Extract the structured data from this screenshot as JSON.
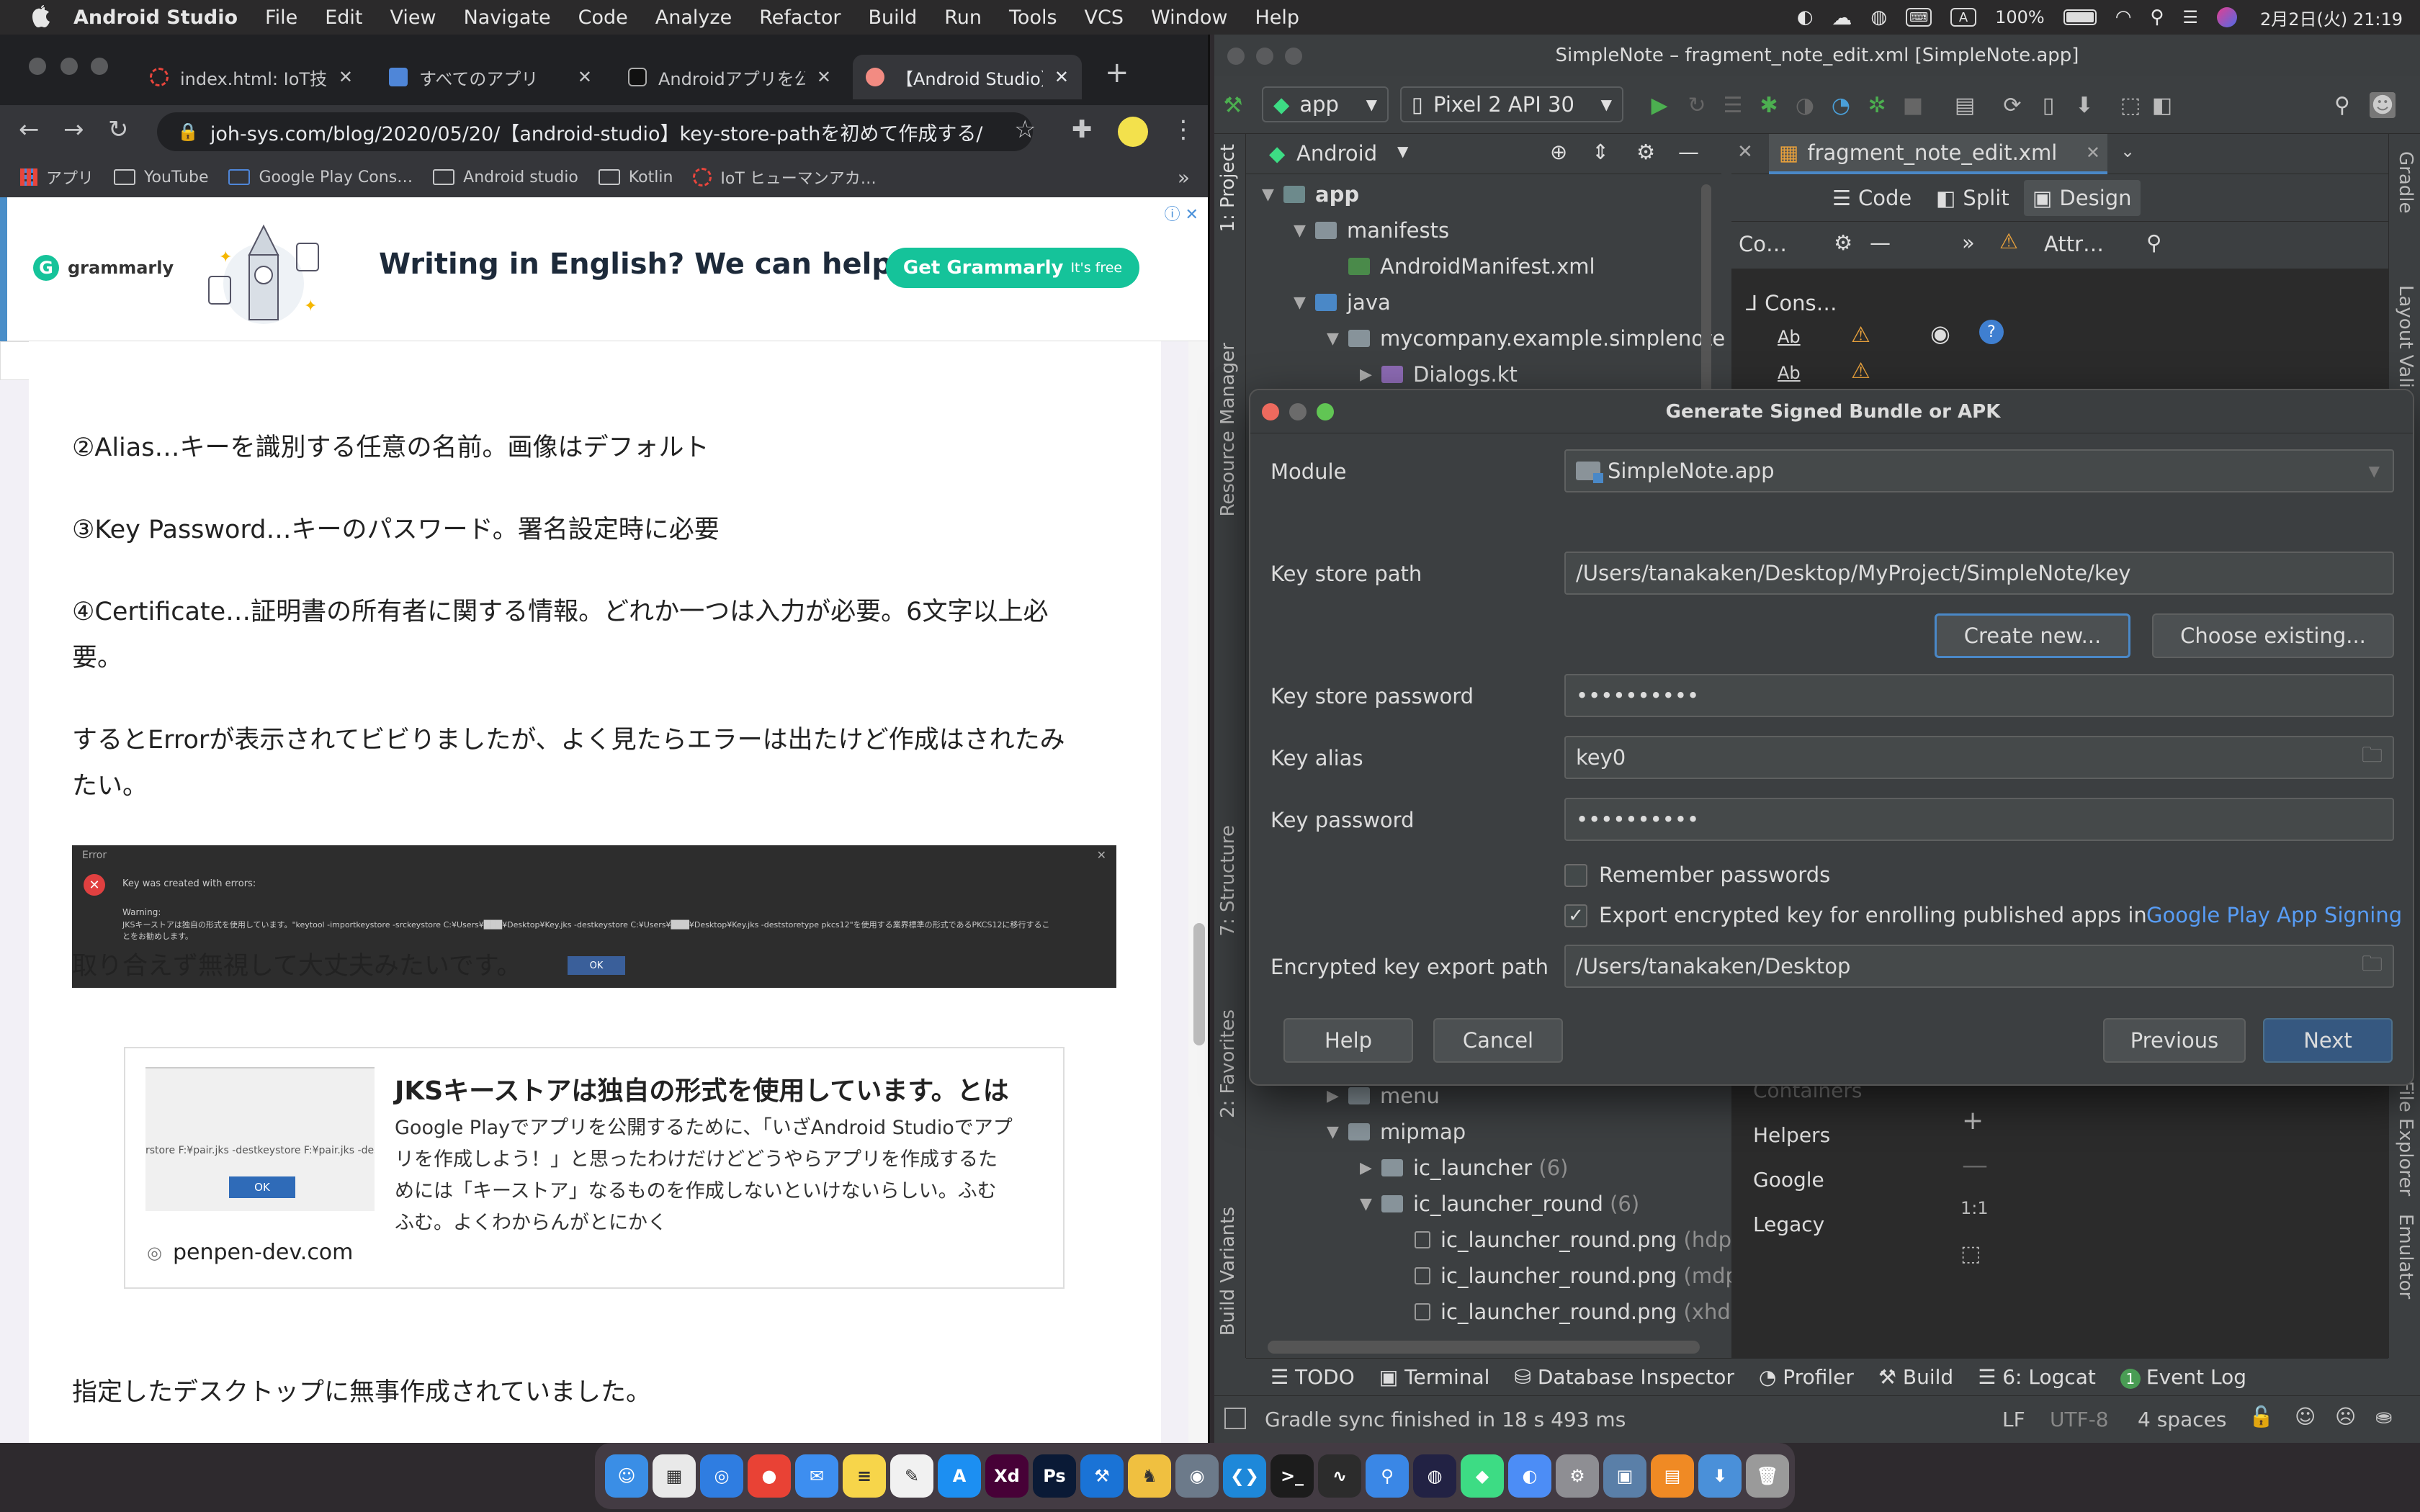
{
  "menubar": {
    "items": [
      "Android Studio",
      "File",
      "Edit",
      "View",
      "Navigate",
      "Code",
      "Analyze",
      "Refactor",
      "Build",
      "Run",
      "Tools",
      "VCS",
      "Window",
      "Help"
    ],
    "battery": "100%",
    "datetime": "2月2日(火)  21:19",
    "input_indicator": "A"
  },
  "chrome": {
    "tabs": [
      {
        "title": "index.html: IoT技術",
        "color": "#e8453c"
      },
      {
        "title": "すべてのアプリ",
        "color": "#4f86d8"
      },
      {
        "title": "Androidアプリを公開",
        "color": "#111111"
      },
      {
        "title": "【Android Studio】",
        "color": "#f28b82"
      }
    ],
    "new_tab": "+",
    "url": "joh-sys.com/blog/2020/05/20/【android-studio】key-store-pathを初めて作成する/",
    "bookmarks": [
      "アプリ",
      "YouTube",
      "Google Play Cons…",
      "Android studio",
      "Kotlin",
      "IoT ヒューマンアカ…"
    ],
    "bookmarks_more": "»"
  },
  "ad": {
    "brand": "grammarly",
    "headline": "Writing in English? We can help.",
    "cta": "Get Grammarly",
    "cta_note": "It's free",
    "ad_badge": "ⓘ ✕"
  },
  "article": {
    "p1": "②Alias…キーを識別する任意の名前。画像はデフォルト",
    "p2": "③Key Password…キーのパスワード。署名設定時に必要",
    "p3a": "④Certificate…証明書の所有者に関する情報。どれか一つは入力が必要。6文字以上必",
    "p3b": "要。",
    "p4a": "するとErrorが表示されてビビりましたが、よく見たらエラーは出たけど作成はされたみ",
    "p4b": "たい。",
    "err_title": "Error",
    "err_msg": "Key was created with errors:",
    "err_warning": "Warning:",
    "err_line1": "JKSキーストアは独自の形式を使用しています。\"keytool -importkeystore -srckeystore C:¥Users¥███¥Desktop¥Key.jks -destkeystore C:¥Users¥███¥Desktop¥Key.jks -deststoretype pkcs12\"を使用する業界標準の形式であるPKCS12に移行するこ",
    "err_line2": "とをお勧めします。",
    "err_ok": "OK",
    "p5": "取り合えず無視して大丈夫みたいです。",
    "card_title": "JKSキーストアは独自の形式を使用しています。とは",
    "card_desc1": "Google Playでアプリを公開するために、「いざAndroid Studioでアプ",
    "card_desc2": "リを作成しよう！」と思ったわけだけどどうやらアプリを作成するた",
    "card_desc3": "めには「キーストア」なるものを作成しないといけないらしい。ふむ",
    "card_desc4": "ふむ。よくわからんがとにかく",
    "card_thumb_text": "rstore F:¥pair.jks -destkeystore F:¥pair.jks -dest",
    "card_thumb_ok": "OK",
    "card_site": "penpen-dev.com",
    "p6": "指定したデスクトップに無事作成されていました。"
  },
  "studio": {
    "title": "SimpleNote – fragment_note_edit.xml [SimpleNote.app]",
    "run_config": "app",
    "device": "Pixel 2 API 30",
    "project_view": "Android",
    "left_tabs": [
      "1: Project",
      "Resource Manager",
      "7: Structure",
      "2: Favorites",
      "Build Variants"
    ],
    "right_tabs": [
      "Gradle",
      "Layout Validation",
      "Device File Explorer",
      "Emulator"
    ],
    "tree": [
      {
        "label": "app",
        "bold": true
      },
      {
        "label": "manifests"
      },
      {
        "label": "AndroidManifest.xml"
      },
      {
        "label": "java"
      },
      {
        "label": "mycompany.example.simplenote"
      },
      {
        "label": "Dialogs.kt"
      },
      {
        "label": "menu"
      },
      {
        "label": "mipmap"
      },
      {
        "label": "ic_launcher",
        "suffix": "(6)"
      },
      {
        "label": "ic_launcher_round",
        "suffix": "(6)"
      },
      {
        "label": "ic_launcher_round.png",
        "suffix": "(hdpi)"
      },
      {
        "label": "ic_launcher_round.png",
        "suffix": "(mdpi)"
      },
      {
        "label": "ic_launcher_round.png",
        "suffix": "(xhdpi)"
      }
    ],
    "editor_tab": "fragment_note_edit.xml",
    "view_modes": [
      "Code",
      "Split",
      "Design"
    ],
    "palette_label": "Co…",
    "attr_label": "Attr…",
    "tree_item": "Cons…",
    "tree_ab": "Ab",
    "palette_items": [
      "Containers",
      "Helpers",
      "Google",
      "Legacy"
    ],
    "zoom": "1:1",
    "bottom_tools": [
      "TODO",
      "Terminal",
      "Database Inspector",
      "Profiler",
      "Build",
      "6: Logcat",
      "Event Log"
    ],
    "event_count": "1",
    "status_msg": "Gradle sync finished in 18 s 493 ms",
    "status_right": [
      "LF",
      "UTF-8",
      "4 spaces"
    ]
  },
  "dialog": {
    "title": "Generate Signed Bundle or APK",
    "module_label": "Module",
    "module_value": "SimpleNote.app",
    "keystore_path_label": "Key store path",
    "keystore_path_value": "/Users/tanakaken/Desktop/MyProject/SimpleNote/key",
    "create_new": "Create new...",
    "choose_existing": "Choose existing...",
    "keystore_password_label": "Key store password",
    "keystore_password_value": "••••••••••",
    "key_alias_label": "Key alias",
    "key_alias_value": "key0",
    "key_password_label": "Key password",
    "key_password_value": "••••••••••",
    "remember_label": "Remember passwords",
    "remember_checked": false,
    "export_label": "Export encrypted key for enrolling published apps in",
    "export_link": "Google Play App Signing",
    "export_checked": true,
    "export_path_label": "Encrypted key export path",
    "export_path_value": "/Users/tanakaken/Desktop",
    "help": "Help",
    "cancel": "Cancel",
    "previous": "Previous",
    "next": "Next"
  },
  "dock": {
    "apps": [
      {
        "name": "finder",
        "color": "#3a8ee6",
        "glyph": "☺"
      },
      {
        "name": "launchpad",
        "color": "#e9e9e9",
        "glyph": "▦"
      },
      {
        "name": "safari",
        "color": "#2f7de1",
        "glyph": "◎"
      },
      {
        "name": "chrome",
        "color": "#e94235",
        "glyph": "●"
      },
      {
        "name": "mail",
        "color": "#3d8ef0",
        "glyph": "✉"
      },
      {
        "name": "notes",
        "color": "#f7d54a",
        "glyph": "≡"
      },
      {
        "name": "textedit",
        "color": "#f1f1f1",
        "glyph": "✎"
      },
      {
        "name": "app-store",
        "color": "#1c8ff2",
        "glyph": "A"
      },
      {
        "name": "adobe-xd",
        "color": "#470137",
        "glyph": "Xd"
      },
      {
        "name": "photoshop",
        "color": "#0a1a36",
        "glyph": "Ps"
      },
      {
        "name": "xcode",
        "color": "#1a73d6",
        "glyph": "⚒"
      },
      {
        "name": "tableplus",
        "color": "#f0c040",
        "glyph": "♞"
      },
      {
        "name": "sequel-ace",
        "color": "#6c7a8a",
        "glyph": "◉"
      },
      {
        "name": "vscode",
        "color": "#1e88d9",
        "glyph": "❮❯"
      },
      {
        "name": "terminal",
        "color": "#1c1c1c",
        "glyph": ">_"
      },
      {
        "name": "activity-monitor",
        "color": "#2c2c2c",
        "glyph": "∿"
      },
      {
        "name": "maps",
        "color": "#3a87e6",
        "glyph": "⚲"
      },
      {
        "name": "pinball",
        "color": "#222244",
        "glyph": "◍"
      },
      {
        "name": "android-studio",
        "color": "#3ddc84",
        "glyph": "◆"
      },
      {
        "name": "simulator",
        "color": "#4c8df6",
        "glyph": "◐"
      },
      {
        "name": "system-preferences",
        "color": "#8e8e93",
        "glyph": "⚙"
      },
      {
        "name": "preview",
        "color": "#5a7fa8",
        "glyph": "▣"
      },
      {
        "name": "books",
        "color": "#f08a24",
        "glyph": "▤"
      },
      {
        "name": "downloads",
        "color": "#4a90d9",
        "glyph": "⬇"
      },
      {
        "name": "trash",
        "color": "#9a9a9a",
        "glyph": "🗑"
      }
    ]
  }
}
